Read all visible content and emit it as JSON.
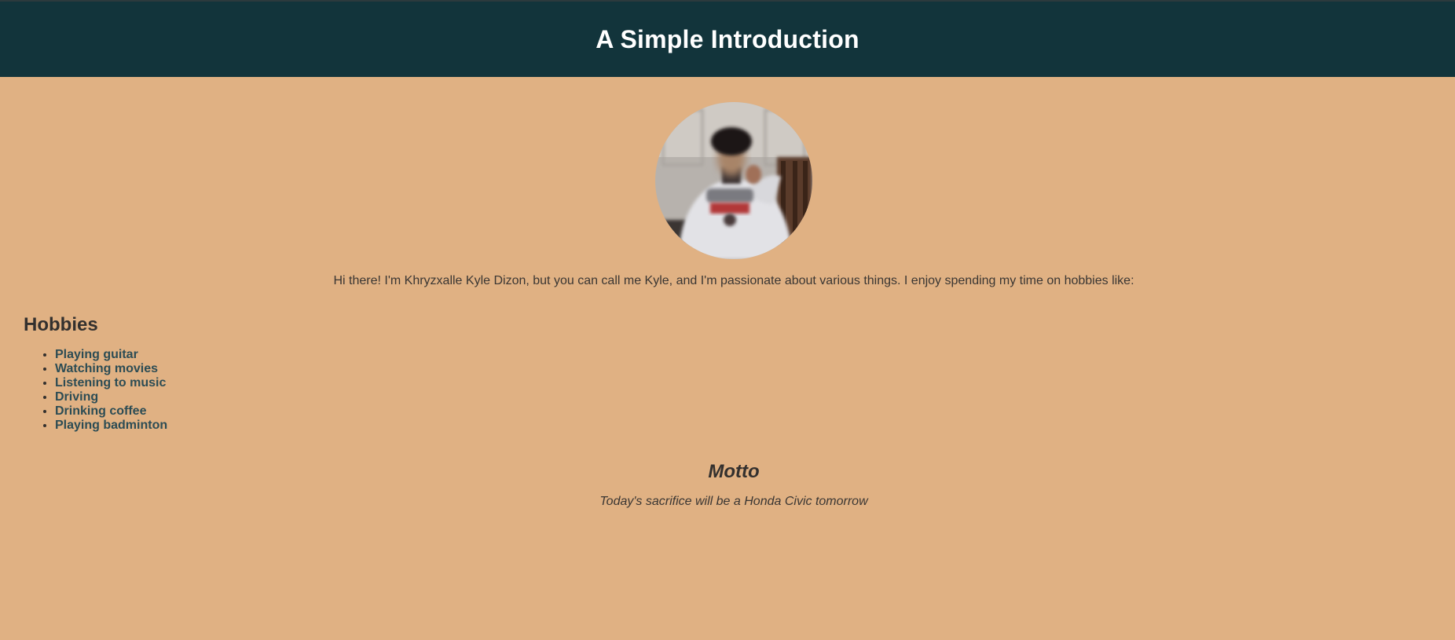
{
  "header": {
    "title": "A Simple Introduction"
  },
  "profile": {
    "image_icon": "profile-photo"
  },
  "intro": {
    "text": "Hi there! I'm Khryzxalle Kyle Dizon, but you can call me Kyle, and I'm passionate about various things. I enjoy spending my time on hobbies like:"
  },
  "hobbies": {
    "heading": "Hobbies",
    "items": [
      "Playing guitar",
      "Watching movies",
      "Listening to music",
      "Driving",
      "Drinking coffee",
      "Playing badminton"
    ]
  },
  "motto": {
    "heading": "Motto",
    "text": "Today's sacrifice will be a Honda Civic tomorrow"
  },
  "colors": {
    "header_bg": "#12343b",
    "page_bg": "#e0b183",
    "hobby_text": "#2c4c54"
  }
}
